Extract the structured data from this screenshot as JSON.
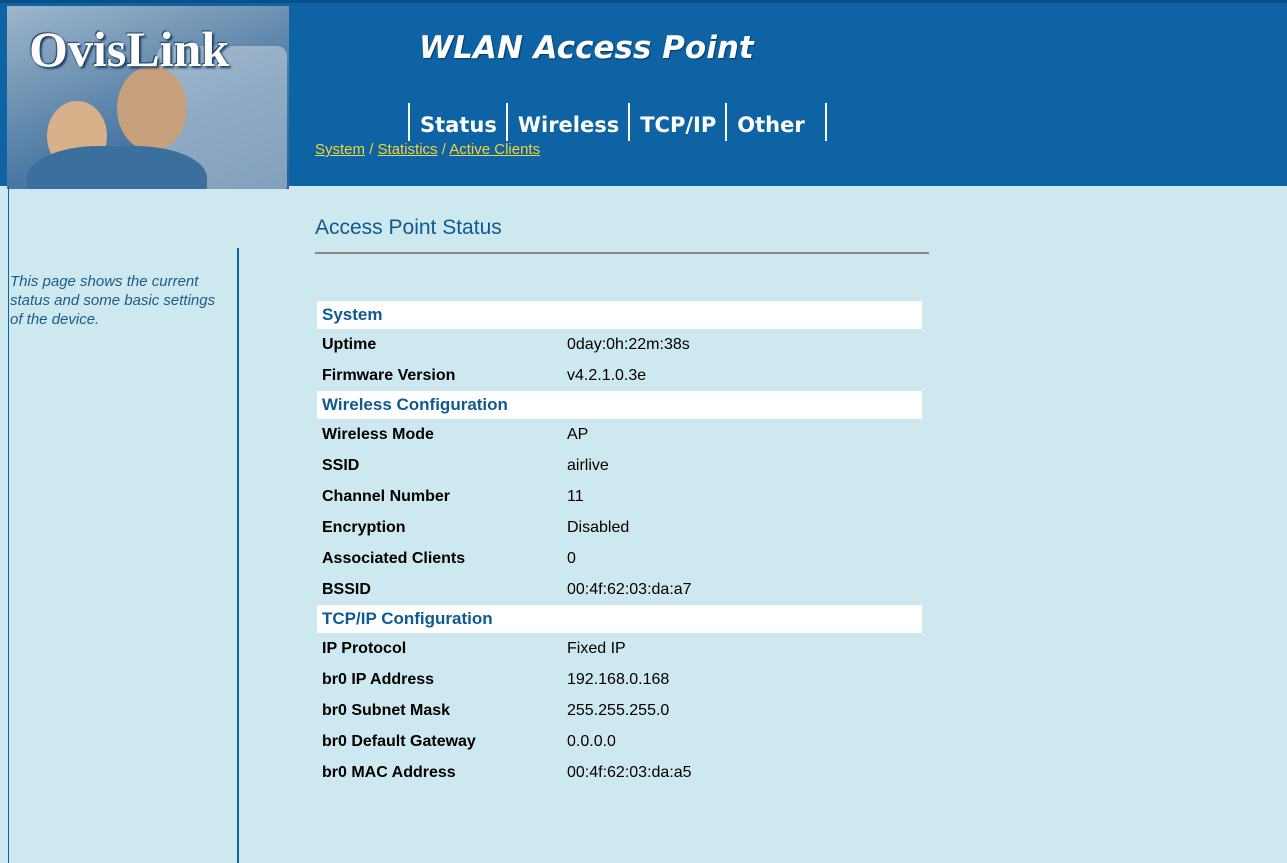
{
  "header": {
    "brand": "OvisLink",
    "product_title": "WLAN Access Point",
    "tabs": [
      {
        "label": "Status"
      },
      {
        "label": "Wireless"
      },
      {
        "label": "TCP/IP"
      },
      {
        "label": "Other"
      }
    ],
    "subnav": [
      {
        "label": "System"
      },
      {
        "label": "Statistics"
      },
      {
        "label": "Active Clients"
      }
    ],
    "subnav_separator": "/"
  },
  "sidebar": {
    "help_text": "This page shows the current status and some basic settings of the device."
  },
  "main": {
    "title": "Access Point Status",
    "sections": [
      {
        "title": "System",
        "rows": [
          {
            "label": "Uptime",
            "value": "0day:0h:22m:38s"
          },
          {
            "label": "Firmware Version",
            "value": "v4.2.1.0.3e"
          }
        ]
      },
      {
        "title": "Wireless Configuration",
        "rows": [
          {
            "label": "Wireless Mode",
            "value": "AP"
          },
          {
            "label": "SSID",
            "value": "airlive"
          },
          {
            "label": "Channel Number",
            "value": "11"
          },
          {
            "label": "Encryption",
            "value": "Disabled"
          },
          {
            "label": "Associated Clients",
            "value": "0"
          },
          {
            "label": "BSSID",
            "value": "00:4f:62:03:da:a7"
          }
        ]
      },
      {
        "title": "TCP/IP Configuration",
        "rows": [
          {
            "label": "IP Protocol",
            "value": "Fixed IP"
          },
          {
            "label": "br0 IP Address",
            "value": "192.168.0.168"
          },
          {
            "label": "br0 Subnet Mask",
            "value": "255.255.255.0"
          },
          {
            "label": "br0 Default Gateway",
            "value": "0.0.0.0"
          },
          {
            "label": "br0 MAC Address",
            "value": "00:4f:62:03:da:a5"
          }
        ]
      }
    ]
  },
  "colors": {
    "header_bg": "#0d63a3",
    "page_bg": "#cde8ee",
    "link_yellow": "#f4d23a",
    "heading_blue": "#0f5a90"
  }
}
